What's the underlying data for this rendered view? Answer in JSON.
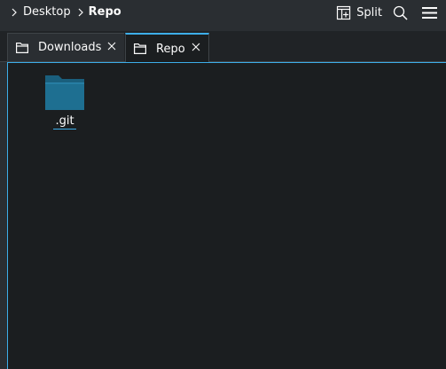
{
  "breadcrumb": {
    "items": [
      "Desktop",
      "Repo"
    ]
  },
  "toolbar": {
    "split_label": "Split",
    "icons": [
      "split-view-icon",
      "search-icon",
      "hamburger-menu-icon"
    ]
  },
  "tabs": [
    {
      "label": "Downloads",
      "active": false
    },
    {
      "label": "Repo",
      "active": true
    }
  ],
  "files": [
    {
      "name": ".git",
      "type": "folder"
    }
  ],
  "colors": {
    "accent": "#3daee9",
    "folder": "#1d6b8c",
    "background": "#1b1e20",
    "chrome": "#2a2e32"
  }
}
